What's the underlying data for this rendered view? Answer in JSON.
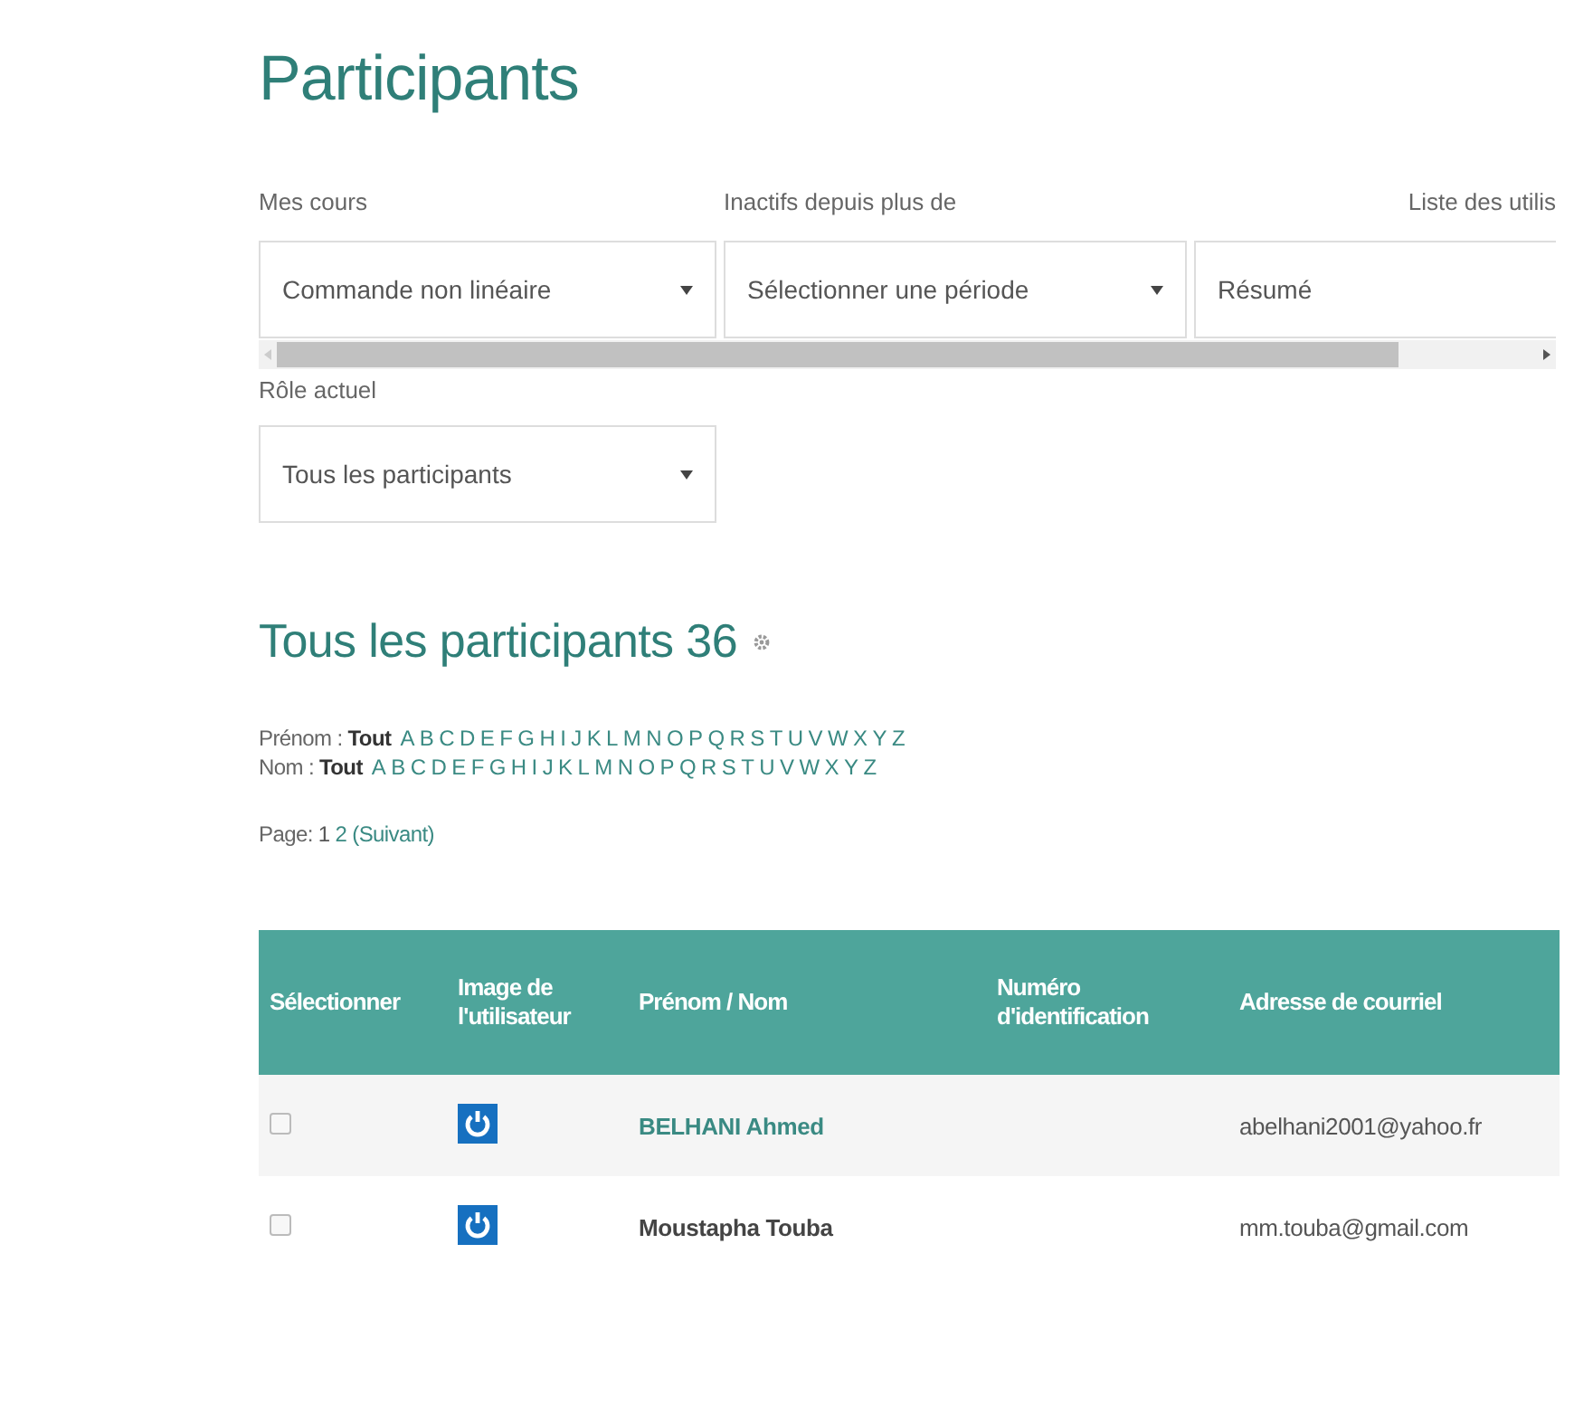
{
  "title": "Participants",
  "filters": [
    {
      "label": "Mes cours",
      "value": "Commande non linéaire",
      "dropdown": true
    },
    {
      "label": "Inactifs depuis plus de",
      "value": "Sélectionner une période",
      "dropdown": true
    },
    {
      "label": "Liste des utilis",
      "value": "Résumé",
      "dropdown": false
    }
  ],
  "role": {
    "label": "Rôle actuel",
    "value": "Tous les participants"
  },
  "heading": "Tous les participants 36",
  "initials": [
    {
      "prefix": "Prénom :",
      "all": "Tout",
      "letters": [
        "A",
        "B",
        "C",
        "D",
        "E",
        "F",
        "G",
        "H",
        "I",
        "J",
        "K",
        "L",
        "M",
        "N",
        "O",
        "P",
        "Q",
        "R",
        "S",
        "T",
        "U",
        "V",
        "W",
        "X",
        "Y",
        "Z"
      ]
    },
    {
      "prefix": "Nom :",
      "all": "Tout",
      "letters": [
        "A",
        "B",
        "C",
        "D",
        "E",
        "F",
        "G",
        "H",
        "I",
        "J",
        "K",
        "L",
        "M",
        "N",
        "O",
        "P",
        "Q",
        "R",
        "S",
        "T",
        "U",
        "V",
        "W",
        "X",
        "Y",
        "Z"
      ]
    }
  ],
  "paging": {
    "label": "Page:",
    "pages": [
      {
        "label": "1",
        "selected": true
      },
      {
        "label": "2",
        "selected": false
      }
    ],
    "next": "(Suivant)"
  },
  "table": {
    "columns": [
      "Sélectionner",
      "Image de l'utilisateur",
      "Prénom / Nom",
      "Numéro d'identification",
      "Adresse de courriel"
    ],
    "rows": [
      {
        "checked": false,
        "name": "BELHANI Ahmed",
        "hovered": true,
        "id_number": "",
        "email": "abelhani2001@yahoo.fr"
      },
      {
        "checked": false,
        "name": "Moustapha Touba",
        "hovered": false,
        "id_number": "",
        "email": "mm.touba@gmail.com"
      }
    ]
  }
}
